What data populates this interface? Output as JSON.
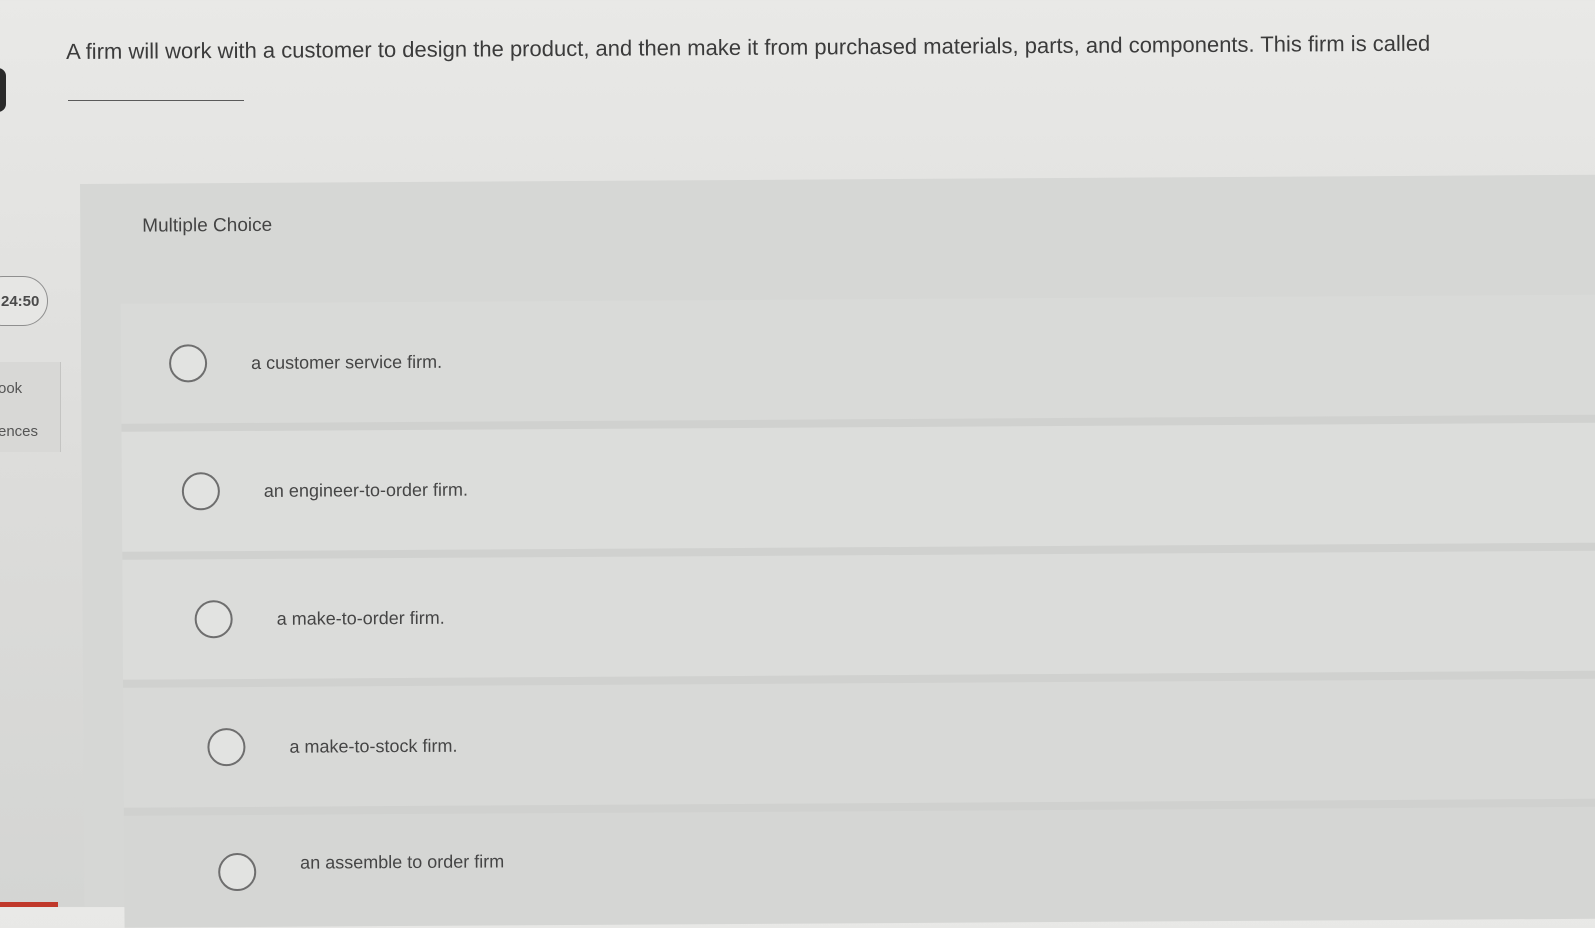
{
  "sidebar": {
    "timer": "24:50",
    "links": [
      "ook",
      "ences"
    ]
  },
  "question": {
    "text": "A firm will work with a customer to design the product, and then make it from purchased materials, parts, and components. This firm is called"
  },
  "choice_section": {
    "label": "Multiple Choice",
    "options": [
      {
        "label": "a customer service firm."
      },
      {
        "label": "an engineer-to-order firm."
      },
      {
        "label": "a make-to-order firm."
      },
      {
        "label": "a make-to-stock firm."
      },
      {
        "label": "an assemble to order firm"
      }
    ]
  }
}
